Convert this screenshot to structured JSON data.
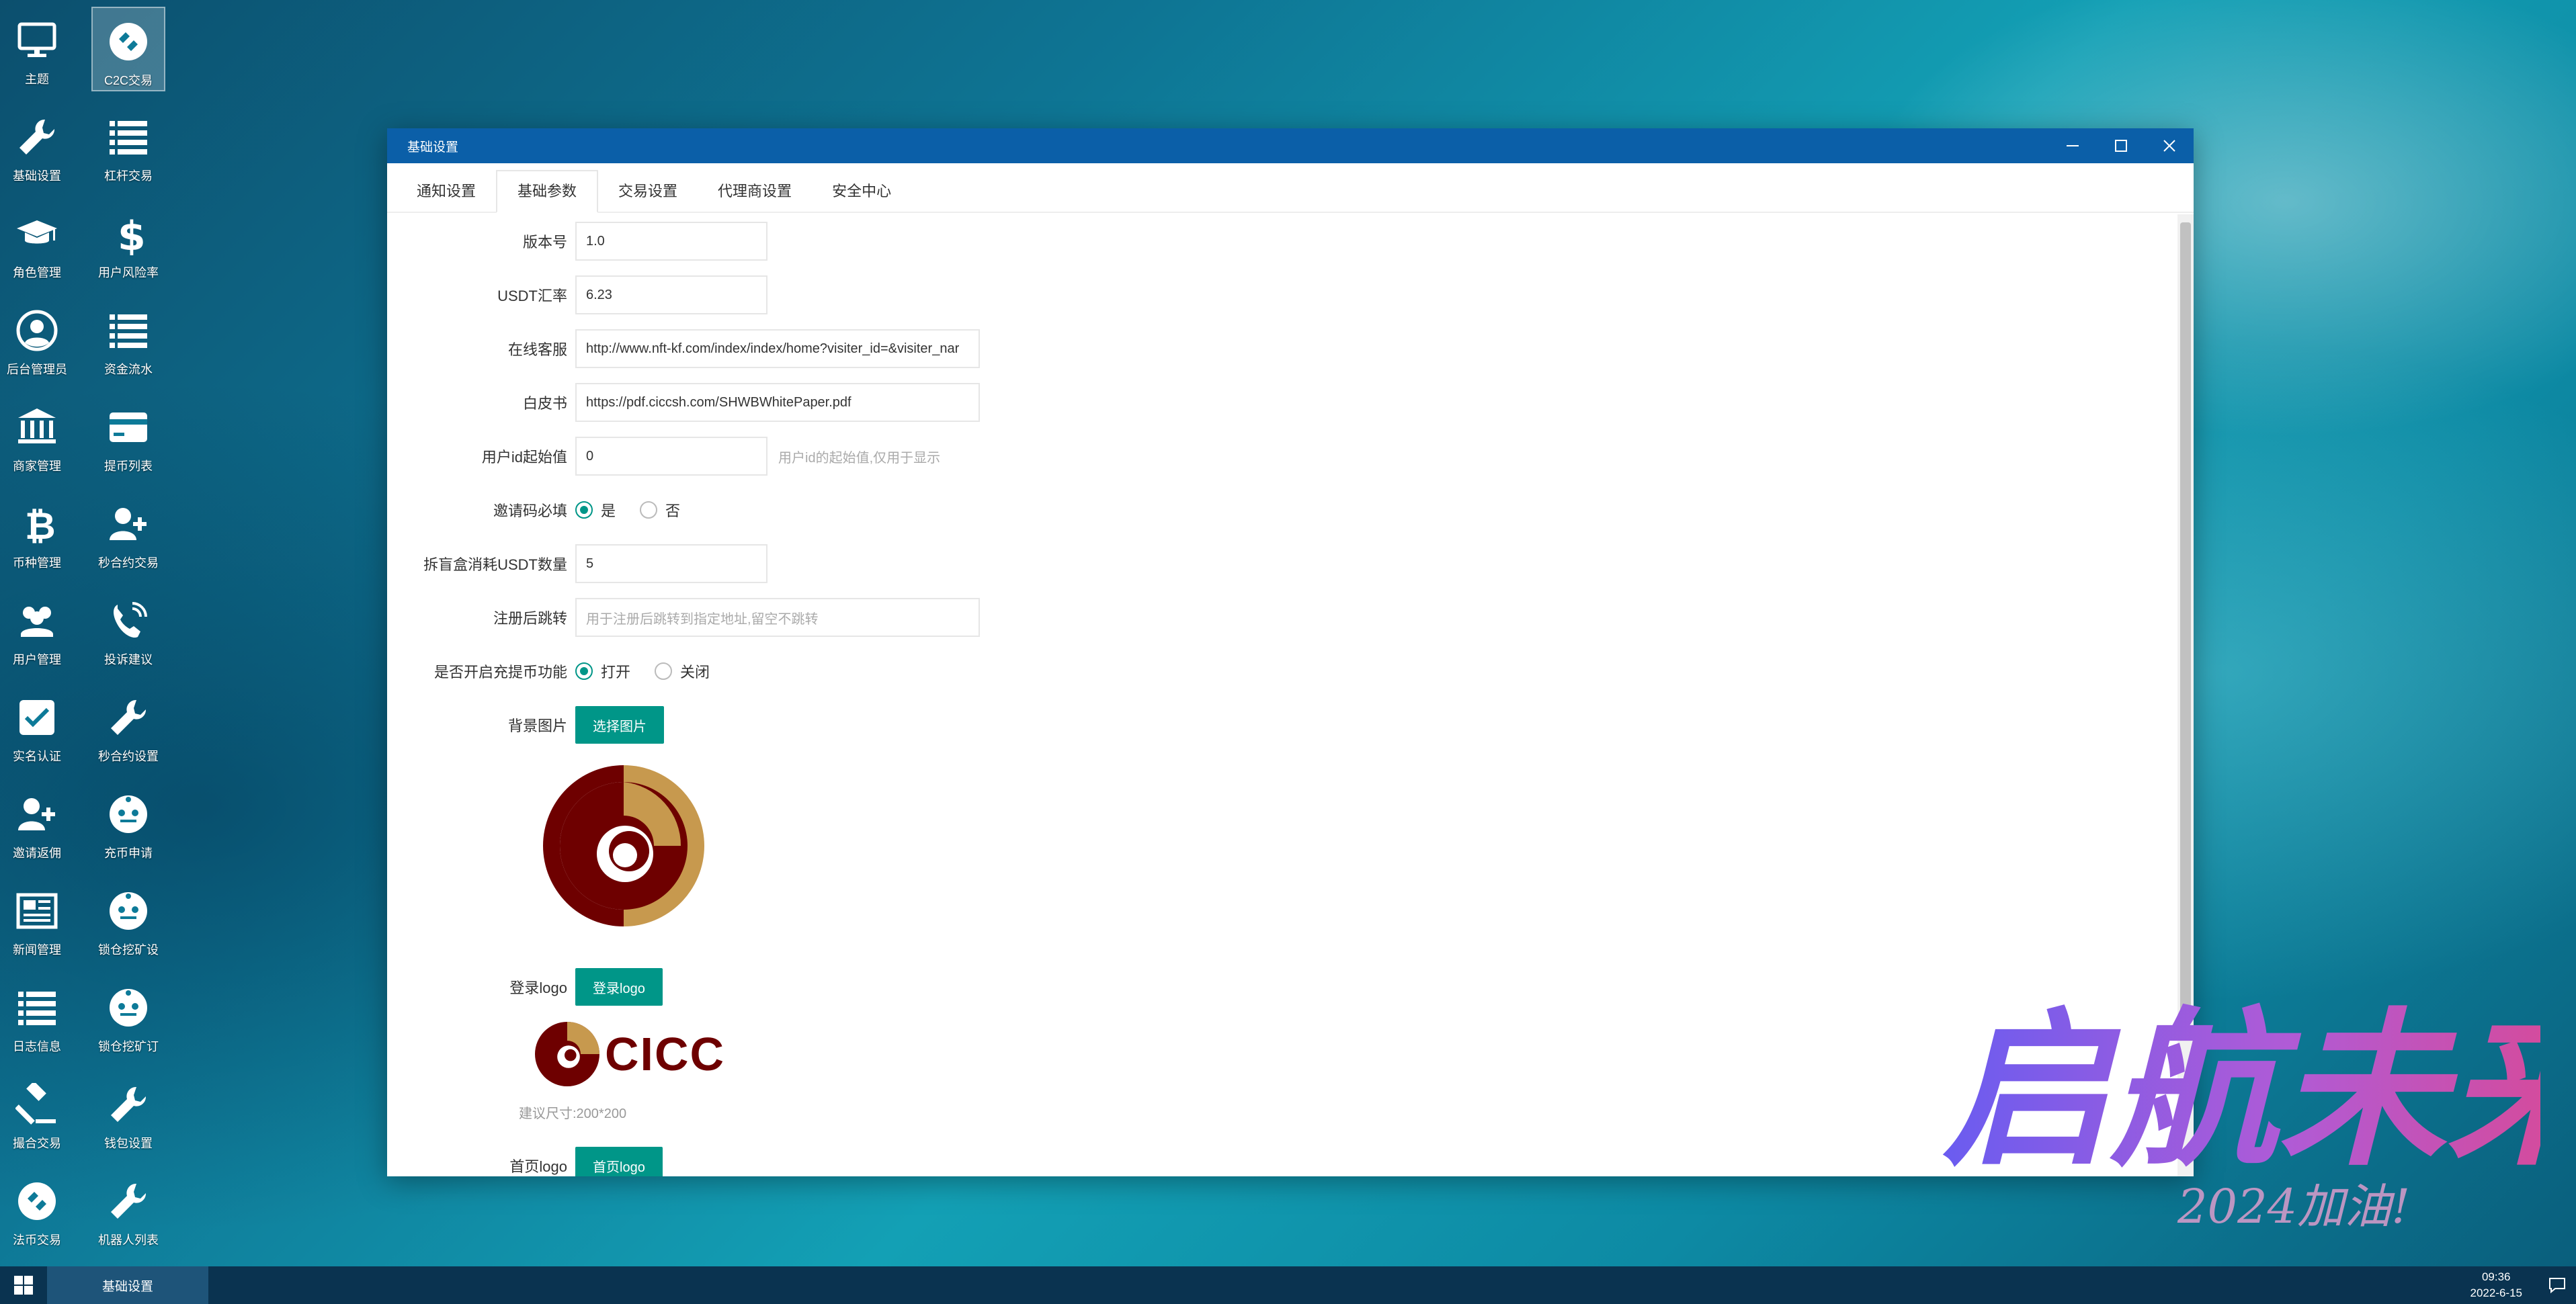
{
  "desktop": {
    "icons_col1": [
      {
        "label": "主题",
        "icon": "monitor-icon"
      },
      {
        "label": "基础设置",
        "icon": "wrench-icon"
      },
      {
        "label": "角色管理",
        "icon": "graduation-cap-icon"
      },
      {
        "label": "后台管理员",
        "icon": "user-circle-icon"
      },
      {
        "label": "商家管理",
        "icon": "bank-icon"
      },
      {
        "label": "币种管理",
        "icon": "bitcoin-icon"
      },
      {
        "label": "用户管理",
        "icon": "users-icon"
      },
      {
        "label": "实名认证",
        "icon": "check-square-icon"
      },
      {
        "label": "邀请返佣",
        "icon": "user-plus-icon"
      },
      {
        "label": "新闻管理",
        "icon": "newspaper-icon"
      },
      {
        "label": "日志信息",
        "icon": "list-icon"
      },
      {
        "label": "撮合交易",
        "icon": "gavel-icon"
      },
      {
        "label": "法币交易",
        "icon": "exchange-icon"
      }
    ],
    "icons_col2": [
      {
        "label": "C2C交易",
        "icon": "exchange-icon",
        "selected": true
      },
      {
        "label": "杠杆交易",
        "icon": "list-icon"
      },
      {
        "label": "用户风险率",
        "icon": "dollar-icon"
      },
      {
        "label": "资金流水",
        "icon": "list-icon"
      },
      {
        "label": "提币列表",
        "icon": "credit-card-icon"
      },
      {
        "label": "秒合约交易",
        "icon": "user-plus-icon"
      },
      {
        "label": "投诉建议",
        "icon": "phone-icon"
      },
      {
        "label": "秒合约设置",
        "icon": "wrench-icon"
      },
      {
        "label": "充币申请",
        "icon": "robot-icon"
      },
      {
        "label": "锁仓挖矿设",
        "icon": "robot-icon"
      },
      {
        "label": "锁仓挖矿订",
        "icon": "robot-icon"
      },
      {
        "label": "钱包设置",
        "icon": "wrench-icon"
      },
      {
        "label": "机器人列表",
        "icon": "wrench-icon"
      }
    ]
  },
  "window": {
    "title": "基础设置",
    "tabs": [
      "通知设置",
      "基础参数",
      "交易设置",
      "代理商设置",
      "安全中心"
    ],
    "active_tab": 1,
    "form": {
      "version": {
        "label": "版本号",
        "value": "1.0"
      },
      "usdt_rate": {
        "label": "USDT汇率",
        "value": "6.23"
      },
      "online_service": {
        "label": "在线客服",
        "value": "http://www.nft-kf.com/index/index/home?visiter_id=&visiter_nar"
      },
      "whitepaper": {
        "label": "白皮书",
        "value": "https://pdf.ciccsh.com/SHWBWhitePaper.pdf"
      },
      "user_id_start": {
        "label": "用户id起始值",
        "value": "0",
        "hint": "用户id的起始值,仅用于显示"
      },
      "invite_required": {
        "label": "邀请码必填",
        "options": [
          "是",
          "否"
        ],
        "selected": 0
      },
      "blindbox_cost": {
        "label": "拆盲盒消耗USDT数量",
        "value": "5"
      },
      "register_redirect": {
        "label": "注册后跳转",
        "placeholder": "用于注册后跳转到指定地址,留空不跳转"
      },
      "recharge_enabled": {
        "label": "是否开启充提币功能",
        "options": [
          "打开",
          "关闭"
        ],
        "selected": 0
      },
      "bg_image": {
        "label": "背景图片",
        "button": "选择图片"
      },
      "login_logo": {
        "label": "登录logo",
        "button": "登录logo",
        "logo_text": "CICC",
        "size_hint": "建议尺寸:200*200"
      },
      "home_logo": {
        "label": "首页logo",
        "button": "首页logo"
      }
    }
  },
  "taskbar": {
    "active_item": "基础设置",
    "time": "09:36",
    "date": "2022-6-15"
  },
  "colors": {
    "accent": "#009688",
    "titlebar": "#0b5fa8",
    "logo_dark": "#6e0000",
    "logo_gold": "#c7994e"
  },
  "overlay_text": {
    "calligraphy": "启航未来",
    "sub": "2024加油!"
  }
}
